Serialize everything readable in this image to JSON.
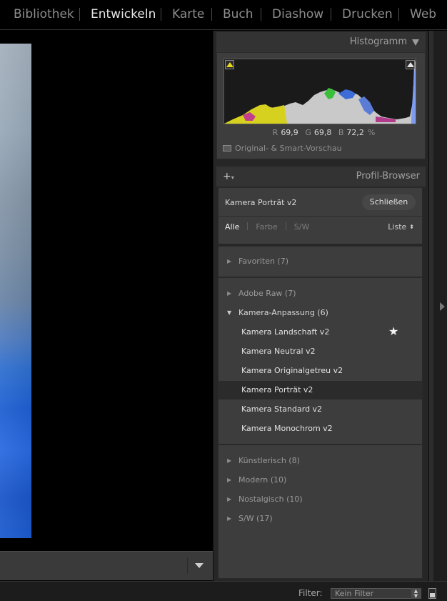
{
  "modules": [
    {
      "label": "Bibliothek",
      "active": false
    },
    {
      "label": "Entwickeln",
      "active": true
    },
    {
      "label": "Karte",
      "active": false
    },
    {
      "label": "Buch",
      "active": false
    },
    {
      "label": "Diashow",
      "active": false
    },
    {
      "label": "Drucken",
      "active": false
    },
    {
      "label": "Web",
      "active": false
    }
  ],
  "histogram": {
    "title": "Histogramm",
    "r_label": "R",
    "r_value": "69,9",
    "g_label": "G",
    "g_value": "69,8",
    "b_label": "B",
    "b_value": "72,2",
    "unit": "%",
    "smart_preview": "Original- & Smart-Vorschau"
  },
  "profile_browser": {
    "title": "Profil-Browser",
    "current_profile": "Kamera Porträt v2",
    "close_label": "Schließen",
    "tabs": [
      {
        "label": "Alle",
        "active": true
      },
      {
        "label": "Farbe",
        "active": false
      },
      {
        "label": "S/W",
        "active": false
      }
    ],
    "view_mode": "Liste",
    "favorites": "Favoriten (7)",
    "groups_top": [
      "Adobe Raw (7)"
    ],
    "open_group": "Kamera-Anpassung (6)",
    "profiles": [
      {
        "label": "Kamera Landschaft v2",
        "favorite": true,
        "selected": false
      },
      {
        "label": "Kamera Neutral v2",
        "favorite": false,
        "selected": false
      },
      {
        "label": "Kamera Originalgetreu v2",
        "favorite": false,
        "selected": false
      },
      {
        "label": "Kamera Porträt v2",
        "favorite": false,
        "selected": true
      },
      {
        "label": "Kamera Standard v2",
        "favorite": false,
        "selected": false
      },
      {
        "label": "Kamera Monochrom v2",
        "favorite": false,
        "selected": false
      }
    ],
    "groups_bottom": [
      "Künstlerisch (8)",
      "Modern (10)",
      "Nostalgisch (10)",
      "S/W (17)"
    ]
  },
  "bottom_bar": {
    "filter_label": "Filter:",
    "filter_value": "Kein Filter"
  },
  "colors": {
    "accent_yellow": "#e8d81a",
    "selected_row": "#2b2b2b",
    "panel_bg": "#3d3d3d"
  },
  "icons": [
    "triangle-down-icon",
    "clip-warning-icon",
    "preview-icon",
    "plus-icon",
    "star-icon",
    "disclosure-arrow-icon",
    "panel-toggle-icon"
  ]
}
